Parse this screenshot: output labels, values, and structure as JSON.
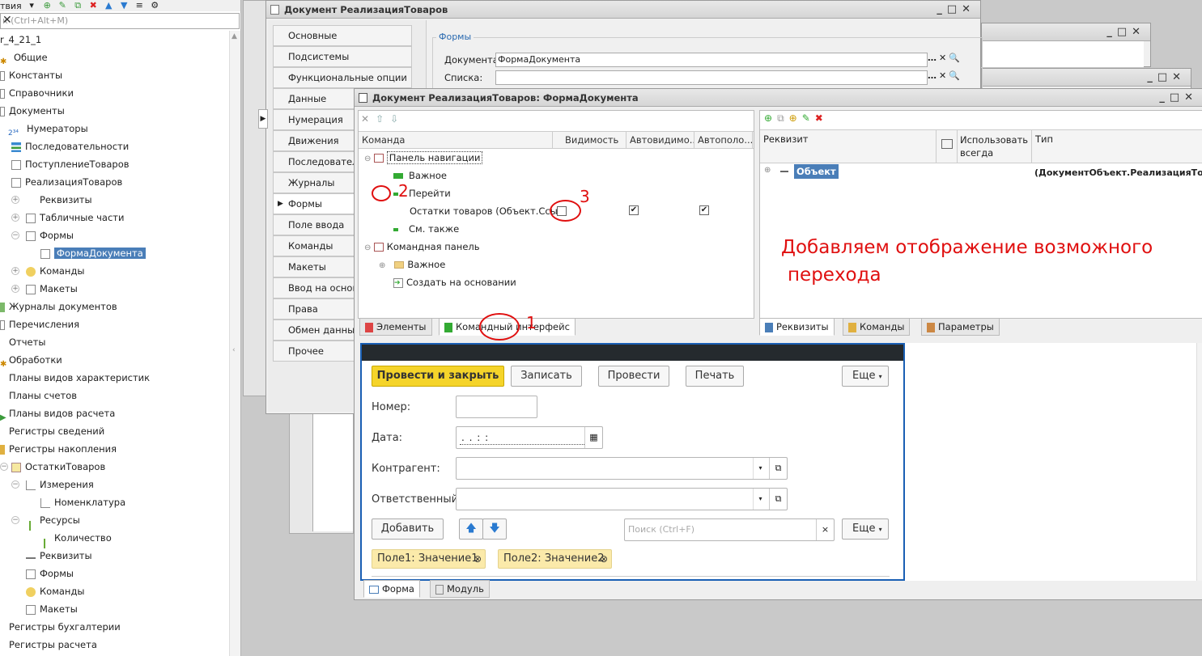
{
  "config_panel": {
    "toolbar_label": "твия",
    "search_placeholder": "к (Ctrl+Alt+M)",
    "tree": [
      {
        "label": "r_4_21_1"
      },
      {
        "label": "Общие"
      },
      {
        "label": "Константы"
      },
      {
        "label": "Справочники"
      },
      {
        "label": "Документы"
      },
      {
        "label": "Нумераторы"
      },
      {
        "label": "Последовательности"
      },
      {
        "label": "ПоступлениеТоваров"
      },
      {
        "label": "РеализацияТоваров"
      },
      {
        "label": "Реквизиты"
      },
      {
        "label": "Табличные части"
      },
      {
        "label": "Формы"
      },
      {
        "label": "ФормаДокумента"
      },
      {
        "label": "Команды"
      },
      {
        "label": "Макеты"
      },
      {
        "label": "Журналы документов"
      },
      {
        "label": "Перечисления"
      },
      {
        "label": "Отчеты"
      },
      {
        "label": "Обработки"
      },
      {
        "label": "Планы видов характеристик"
      },
      {
        "label": "Планы счетов"
      },
      {
        "label": "Планы видов расчета"
      },
      {
        "label": "Регистры сведений"
      },
      {
        "label": "Регистры накопления"
      },
      {
        "label": "ОстаткиТоваров"
      },
      {
        "label": "Измерения"
      },
      {
        "label": "Номенклатура"
      },
      {
        "label": "Ресурсы"
      },
      {
        "label": "Количество"
      },
      {
        "label": "Реквизиты"
      },
      {
        "label": "Формы"
      },
      {
        "label": "Команды"
      },
      {
        "label": "Макеты"
      },
      {
        "label": "Регистры бухгалтерии"
      },
      {
        "label": "Регистры расчета"
      }
    ]
  },
  "doc_window": {
    "title": "Документ РеализацияТоваров",
    "tabs": [
      "Основные",
      "Подсистемы",
      "Функциональные опции",
      "Данные",
      "Нумерация",
      "Движения",
      "Последователь",
      "Журналы",
      "Формы",
      "Поле ввода",
      "Команды",
      "Макеты",
      "Ввод на основа",
      "Права",
      "Обмен данными",
      "Прочее"
    ],
    "forms_group": "Формы",
    "doc_label": "Документа:",
    "doc_value": "ФормаДокумента",
    "list_label": "Списка:"
  },
  "form_window": {
    "title": "Документ РеализацияТоваров: ФормаДокумента",
    "cmd_headers": [
      "Команда",
      "Видимость",
      "Автовидимо...",
      "Автополо..."
    ],
    "cmd_rows": [
      "Панель навигации",
      "Важное",
      "Перейти",
      "Остатки товаров (Объект.Ссы...",
      "См. также",
      "Командная панель",
      "Важное",
      "Создать на основании"
    ],
    "req_headers": [
      "Реквизит",
      "Использовать всегда",
      "Тип"
    ],
    "req_object": "Объект",
    "req_type": "(ДокументОбъект.РеализацияТов...",
    "left_tabs": [
      "Элементы",
      "Командный интерфейс"
    ],
    "right_tabs": [
      "Реквизиты",
      "Команды",
      "Параметры"
    ],
    "bottom_tabs": [
      "Форма",
      "Модуль"
    ]
  },
  "preview": {
    "btn_post_close": "Провести и закрыть",
    "btn_write": "Записать",
    "btn_post": "Провести",
    "btn_print": "Печать",
    "btn_more": "Еще",
    "label_number": "Номер:",
    "label_date": "Дата:",
    "date_mask": ". .    : :",
    "label_contractor": "Контрагент:",
    "label_responsible": "Ответственный:",
    "btn_add": "Добавить",
    "search_placeholder": "Поиск (Ctrl+F)",
    "tag1": "Поле1: Значение1",
    "tag2": "Поле2: Значение2"
  },
  "annotation": {
    "text1": "Добавляем отображение возможного",
    "text2": "перехода",
    "n1": "1",
    "n2": "2",
    "n3": "3",
    "color": "#e01010"
  }
}
